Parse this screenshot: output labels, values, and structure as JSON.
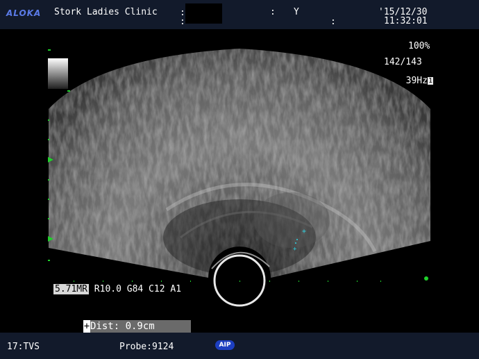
{
  "header": {
    "brand": "ALOKA",
    "clinic": "Stork Ladies Clinic",
    "colon1": ":",
    "colon2": ":",
    "colon3": ":",
    "sex": "Y",
    "colon4": ":",
    "date": "'15/12/30",
    "time": "11:32:01"
  },
  "display": {
    "zoom": "100%",
    "frame_count": "142/143",
    "frame_rate": "39Hz",
    "probe_slot": "1"
  },
  "scan_params": {
    "depth": "5.71MR",
    "rest": " R10.0 G84 C12 A1"
  },
  "measurement": {
    "icon": "+",
    "text": "Dist:   0.9cm"
  },
  "footer": {
    "preset": "17:TVS",
    "probe": "Probe:9124",
    "aip_badge": "AIP"
  },
  "colors": {
    "bar_background": "#121a2b",
    "marker_green": "#1fd12b",
    "caliper_cyan": "#2fd6e6",
    "aip_blue": "#1d3fc0"
  }
}
